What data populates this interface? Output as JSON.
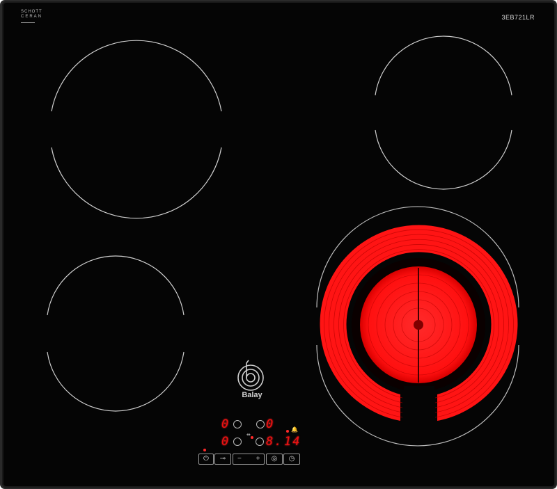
{
  "brand_top": {
    "line1": "SCHOTT",
    "line2": "CERAN"
  },
  "model": "3EB721LR",
  "brand": {
    "name": "Balay"
  },
  "displays": {
    "row1_left": "0",
    "row1_right": "0",
    "row2_left": "0",
    "row2_right": "8.",
    "timer": "14"
  },
  "controls": {
    "power": "power-icon",
    "lock": "key-icon",
    "minus": "−",
    "plus": "+",
    "zone_select": "zone-icon",
    "timer": "clock-icon"
  },
  "colors": {
    "glass": "#050505",
    "heat": "#ff1a1a",
    "display": "#ee1111"
  }
}
